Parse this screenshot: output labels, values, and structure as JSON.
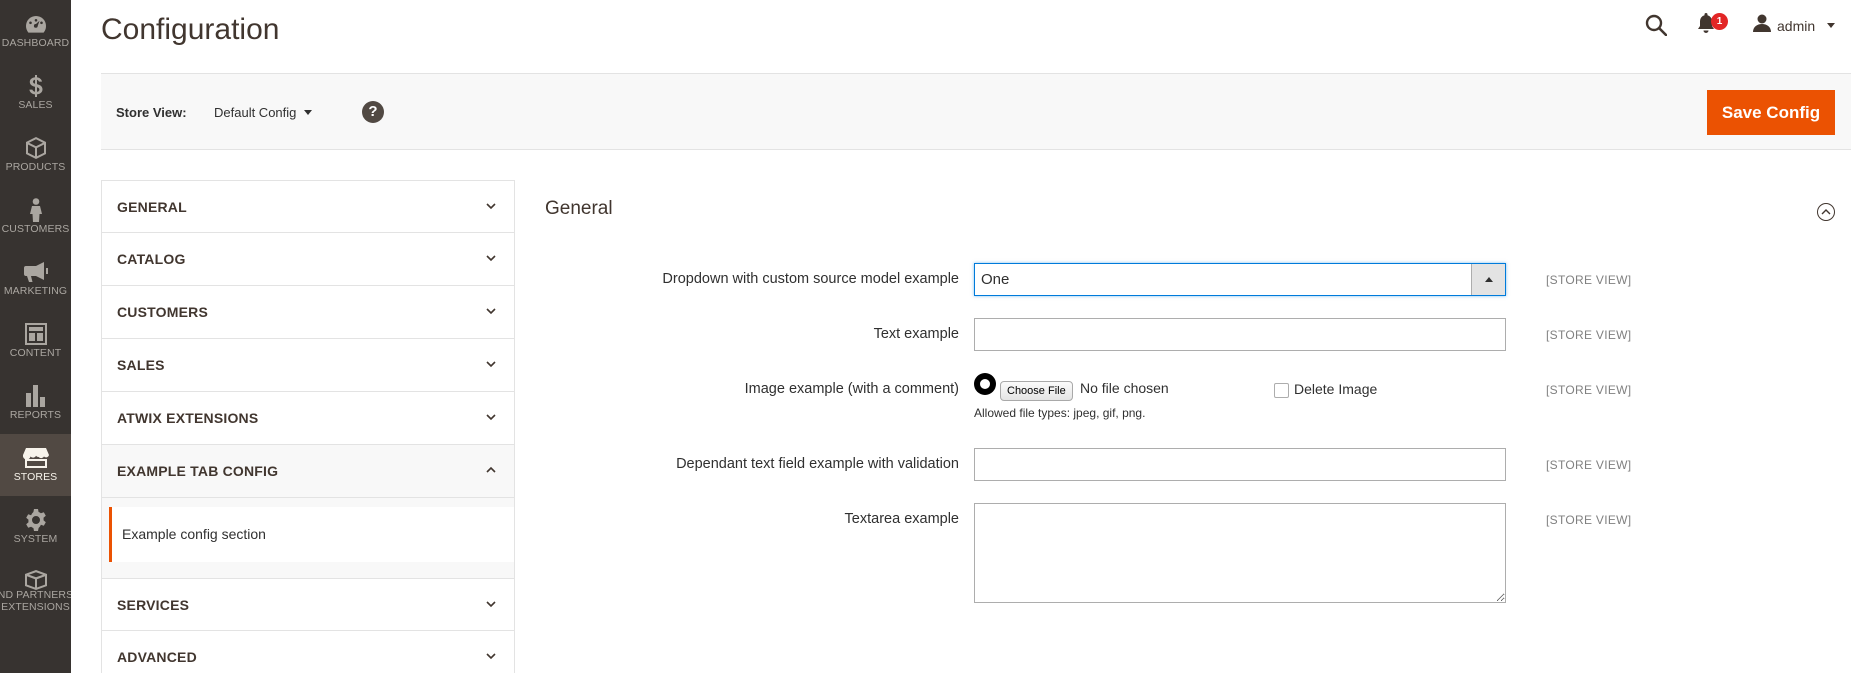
{
  "nav": {
    "items": [
      {
        "label": "Dashboard",
        "icon": "dashboard-icon"
      },
      {
        "label": "Sales",
        "icon": "dollar-icon"
      },
      {
        "label": "Products",
        "icon": "box-icon"
      },
      {
        "label": "Customers",
        "icon": "person-icon"
      },
      {
        "label": "Marketing",
        "icon": "megaphone-icon"
      },
      {
        "label": "Content",
        "icon": "layout-icon"
      },
      {
        "label": "Reports",
        "icon": "bar-chart-icon"
      },
      {
        "label": "Stores",
        "icon": "store-icon",
        "active": true
      },
      {
        "label": "System",
        "icon": "gear-icon"
      },
      {
        "label": "Find Partners & Extensions",
        "label_line1": "nd Partners",
        "label_line2": "Extensions",
        "icon": "partners-box-icon"
      }
    ]
  },
  "header": {
    "title": "Configuration",
    "notification_count": "1",
    "user_name": "admin"
  },
  "store_bar": {
    "label": "Store View:",
    "selected": "Default Config",
    "help": "?",
    "save_label": "Save Config"
  },
  "tabs": [
    {
      "title": "General"
    },
    {
      "title": "Catalog"
    },
    {
      "title": "Customers"
    },
    {
      "title": "Sales"
    },
    {
      "title": "Atwix Extensions"
    },
    {
      "title": "Example Tab Config",
      "open": true,
      "sections": [
        "Example config section"
      ]
    },
    {
      "title": "Services"
    },
    {
      "title": "Advanced"
    }
  ],
  "section": {
    "title": "General",
    "scope": "[STORE VIEW]",
    "fields": {
      "dropdown": {
        "label": "Dropdown with custom source model example",
        "value": "One"
      },
      "text": {
        "label": "Text example",
        "value": ""
      },
      "image": {
        "label": "Image example (with a comment)",
        "choose_label": "Choose File",
        "status": "No file chosen",
        "comment": "Allowed file types: jpeg, gif, png.",
        "delete_label": "Delete Image"
      },
      "dependant": {
        "label": "Dependant text field example with validation",
        "value": ""
      },
      "textarea": {
        "label": "Textarea example",
        "value": ""
      }
    }
  },
  "colors": {
    "nav_bg": "#373330",
    "nav_active": "#514943",
    "accent": "#eb5202",
    "focus": "#007bdb"
  }
}
